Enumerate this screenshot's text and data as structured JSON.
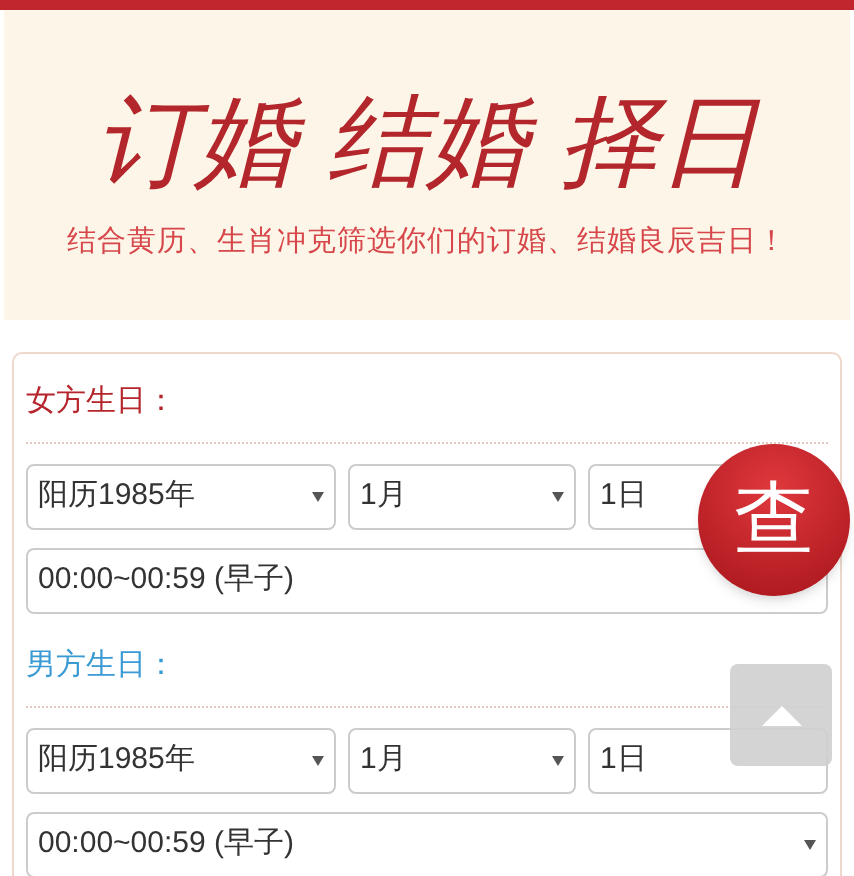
{
  "banner": {
    "title": "订婚 结婚 择日",
    "subtitle": "结合黄历、生肖冲克筛选你们的订婚、结婚良辰吉日！"
  },
  "groups": [
    {
      "kind": "female",
      "label": "女方生日：",
      "year": "阳历1985年",
      "month": "1月",
      "day": "1日",
      "time": "00:00~00:59 (早子)"
    },
    {
      "kind": "male",
      "label": "男方生日：",
      "year": "阳历1985年",
      "month": "1月",
      "day": "1日",
      "time": "00:00~00:59 (早子)"
    }
  ],
  "query_button": "查"
}
